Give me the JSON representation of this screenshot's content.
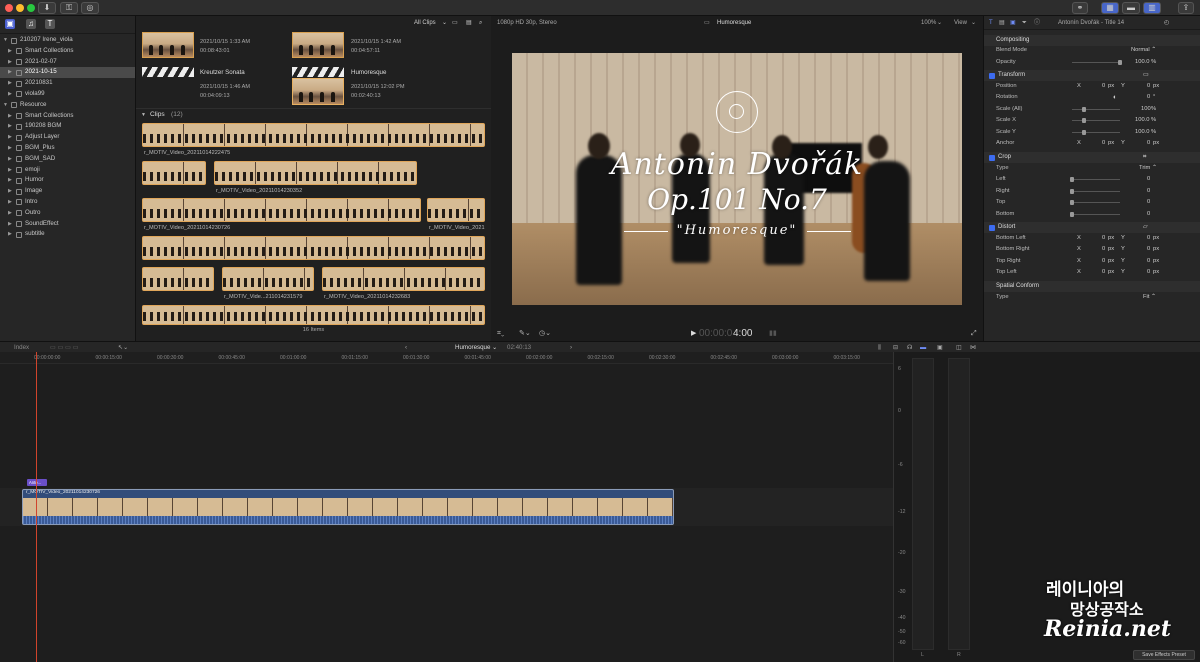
{
  "toolbar": {
    "icons": [
      "import-icon",
      "keywords-icon",
      "background-tasks-icon"
    ],
    "right_icons": [
      "share-icon"
    ]
  },
  "library": {
    "items": [
      {
        "label": "210207 Irene_viola",
        "level": 0,
        "expanded": true
      },
      {
        "label": "Smart Collections",
        "level": 1
      },
      {
        "label": "2021-02-07",
        "level": 1
      },
      {
        "label": "2021-10-15",
        "level": 1,
        "selected": true
      },
      {
        "label": "20210831",
        "level": 1
      },
      {
        "label": "viola99",
        "level": 1
      },
      {
        "label": "Resource",
        "level": 0,
        "expanded": true
      },
      {
        "label": "Smart Collections",
        "level": 1
      },
      {
        "label": "190208 BGM",
        "level": 1
      },
      {
        "label": "Adjust Layer",
        "level": 1
      },
      {
        "label": "BGM_Plus",
        "level": 1
      },
      {
        "label": "BGM_SAD",
        "level": 1
      },
      {
        "label": "emoji",
        "level": 1
      },
      {
        "label": "Humor",
        "level": 1
      },
      {
        "label": "Image",
        "level": 1
      },
      {
        "label": "Intro",
        "level": 1
      },
      {
        "label": "Outro",
        "level": 1
      },
      {
        "label": "SoundEffect",
        "level": 1
      },
      {
        "label": "subtitle",
        "level": 1
      }
    ]
  },
  "browser": {
    "filter": "All Clips",
    "projects": [
      {
        "title": "",
        "date": "2021/10/15 1:33 AM",
        "duration": "00:08:43:01"
      },
      {
        "title": "",
        "date": "2021/10/15 1:42 AM",
        "duration": "00:04:57:11"
      },
      {
        "title": "Kreutzer Sonata",
        "date": "2021/10/15 1:46 AM",
        "duration": "00:04:09:13"
      },
      {
        "title": "Humoresque",
        "date": "2021/10/15 12:02 PM",
        "duration": "00:02:40:13"
      }
    ],
    "clips_header": "Clips",
    "clips_count": "(12)",
    "clip_names": [
      "r_MOTIV_Video_20211014222475",
      "r_MOTIV_Video_20211014230352",
      "r_MOTIV_Video_20211014230726",
      "r_MOTIV_Video_2021",
      "r_MOTIV_Vide...211014231579",
      "r_MOTIV_Video_20211014232683"
    ],
    "items_count": "16 Items"
  },
  "viewer": {
    "format": "1080p HD 30p, Stereo",
    "project_name": "Humoresque",
    "zoom": "100%",
    "view_label": "View",
    "title_line1": "Antonin Dvořák",
    "title_line2": "Op.101 No.7",
    "title_line3": "\"Humoresque\"",
    "timecode_dim": "00:00:0",
    "timecode": "4:00"
  },
  "inspector": {
    "title": "Antonín Dvořák - Title 14",
    "sections": {
      "compositing": "Compositing",
      "transform": "Transform",
      "crop": "Crop",
      "distort": "Distort",
      "spatial": "Spatial Conform"
    },
    "blend_mode": {
      "label": "Blend Mode",
      "value": "Normal ⌃"
    },
    "opacity": {
      "label": "Opacity",
      "value": "100.0 %"
    },
    "position": {
      "label": "Position",
      "x": "0",
      "y": "0",
      "unit": "px"
    },
    "rotation": {
      "label": "Rotation",
      "value": "0",
      "unit": "°"
    },
    "scale_all": {
      "label": "Scale (All)",
      "value": "100",
      "unit": "%"
    },
    "scale_x": {
      "label": "Scale X",
      "value": "100.0",
      "unit": "%"
    },
    "scale_y": {
      "label": "Scale Y",
      "value": "100.0",
      "unit": "%"
    },
    "anchor": {
      "label": "Anchor",
      "x": "0",
      "y": "0",
      "unit": "px"
    },
    "crop_type": {
      "label": "Type",
      "value": "Trim ⌃"
    },
    "crop_left": {
      "label": "Left",
      "value": "0"
    },
    "crop_right": {
      "label": "Right",
      "value": "0"
    },
    "crop_top": {
      "label": "Top",
      "value": "0"
    },
    "crop_bottom": {
      "label": "Bottom",
      "value": "0"
    },
    "distort_bl": {
      "label": "Bottom Left",
      "x": "0",
      "y": "0",
      "unit": "px"
    },
    "distort_br": {
      "label": "Bottom Right",
      "x": "0",
      "y": "0",
      "unit": "px"
    },
    "distort_tr": {
      "label": "Top Right",
      "x": "0",
      "y": "0",
      "unit": "px"
    },
    "distort_tl": {
      "label": "Top Left",
      "x": "0",
      "y": "0",
      "unit": "px"
    },
    "spatial_type": {
      "label": "Type",
      "value": "Fit ⌃"
    },
    "axis_x": "X",
    "axis_y": "Y",
    "save_preset": "Save Effects Preset"
  },
  "timeline": {
    "index_label": "Index",
    "project_name": "Humoresque ⌄",
    "duration": "02:40:13",
    "ruler": [
      "00:00:00:00",
      "00:00:15:00",
      "00:00:30:00",
      "00:00:45:00",
      "00:01:00:00",
      "00:01:15:00",
      "00:01:30:00",
      "00:01:45:00",
      "00:02:00:00",
      "00:02:15:00",
      "00:02:30:00",
      "00:02:45:00",
      "00:03:00:00",
      "00:03:15:00",
      "00:03:30:00"
    ],
    "title_clip": "Anto...",
    "video_clip": "r_MOTIV_Video_20211014230726"
  },
  "meters": {
    "scale": [
      "6",
      "0",
      "-6",
      "-12",
      "-20",
      "-30",
      "-40",
      "-50",
      "-60"
    ],
    "channels": [
      "L",
      "R"
    ]
  },
  "watermark": {
    "line1": "레이니아의",
    "line2": "망상공작소",
    "line3": "Reinia.net"
  },
  "colors": {
    "accent": "#3d6cf0",
    "clip_border": "#e0a65a",
    "title_clip": "#6a4fc8",
    "playhead": "#d0442c"
  }
}
